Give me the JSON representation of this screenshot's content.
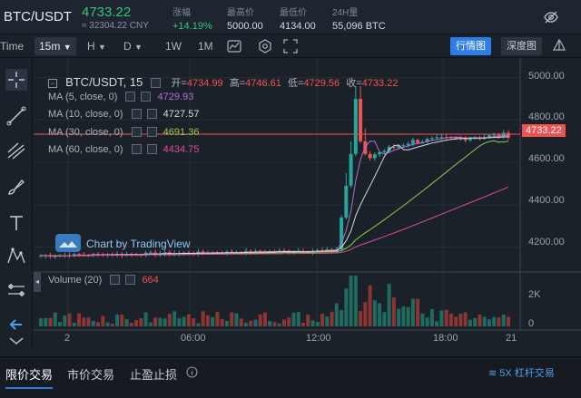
{
  "header": {
    "pair": "BTC/USDT",
    "price": "4733.22",
    "price_cny": "≈ 32304.22 CNY",
    "stats": [
      {
        "label": "涨幅",
        "value": "+14.19%",
        "positive": true
      },
      {
        "label": "最高价",
        "value": "5000.00"
      },
      {
        "label": "最低价",
        "value": "4134.00"
      },
      {
        "label": "24H量",
        "value": "55,096 BTC"
      }
    ],
    "visibility_icon": "eye-off-icon"
  },
  "toolbar": {
    "time_label": "Time",
    "interval": "15m",
    "items": [
      "H",
      "D",
      "1W",
      "1M"
    ],
    "tab_active": "行情图",
    "tab_other": "深度图"
  },
  "chart": {
    "title": "BTC/USDT, 15",
    "o_label": "开=",
    "o": "4734.99",
    "h_label": "高=",
    "h": "4746.61",
    "l_label": "低=",
    "l": "4729.56",
    "c_label": "收=",
    "c": "4733.22",
    "ma": [
      {
        "label": "MA (5, close, 0)",
        "value": "4729.93",
        "color": "#b36bd9"
      },
      {
        "label": "MA (10, close, 0)",
        "value": "4727.57",
        "color": "#d6dbe1"
      },
      {
        "label": "MA (30, close, 0)",
        "value": "4691.36",
        "color": "#8bd14b"
      },
      {
        "label": "MA (60, close, 0)",
        "value": "4434.75",
        "color": "#d94c9a"
      }
    ],
    "volume_label": "Volume (20)",
    "volume_value": "664",
    "watermark": "Chart by TradingView",
    "price_axis": [
      "5000.00",
      "4800.00",
      "4600.00",
      "4400.00",
      "4200.00"
    ],
    "current_price": "4733.22",
    "vol_axis": [
      "2K",
      "0"
    ],
    "time_axis": [
      "2",
      "06:00",
      "12:00",
      "18:00",
      "21"
    ],
    "colors": {
      "up": "#26a69a",
      "down": "#ef5350",
      "grid": "#252d38"
    }
  },
  "chart_data": {
    "type": "candlestick",
    "title": "BTC/USDT, 15",
    "ylim": [
      4100,
      5050
    ],
    "x": [
      "2",
      "06:00",
      "12:00",
      "18:00",
      "21"
    ],
    "series": [
      {
        "name": "MA (5, close, 0)",
        "values": [
          4729.93
        ]
      },
      {
        "name": "MA (10, close, 0)",
        "values": [
          4727.57
        ]
      },
      {
        "name": "MA (30, close, 0)",
        "values": [
          4691.36
        ]
      },
      {
        "name": "MA (60, close, 0)",
        "values": [
          4434.75
        ]
      }
    ]
  },
  "bottom": {
    "tabs": [
      "限价交易",
      "市价交易",
      "止盈止损"
    ],
    "info_icon": "info-icon",
    "leverage": "5X 杠杆交易"
  }
}
